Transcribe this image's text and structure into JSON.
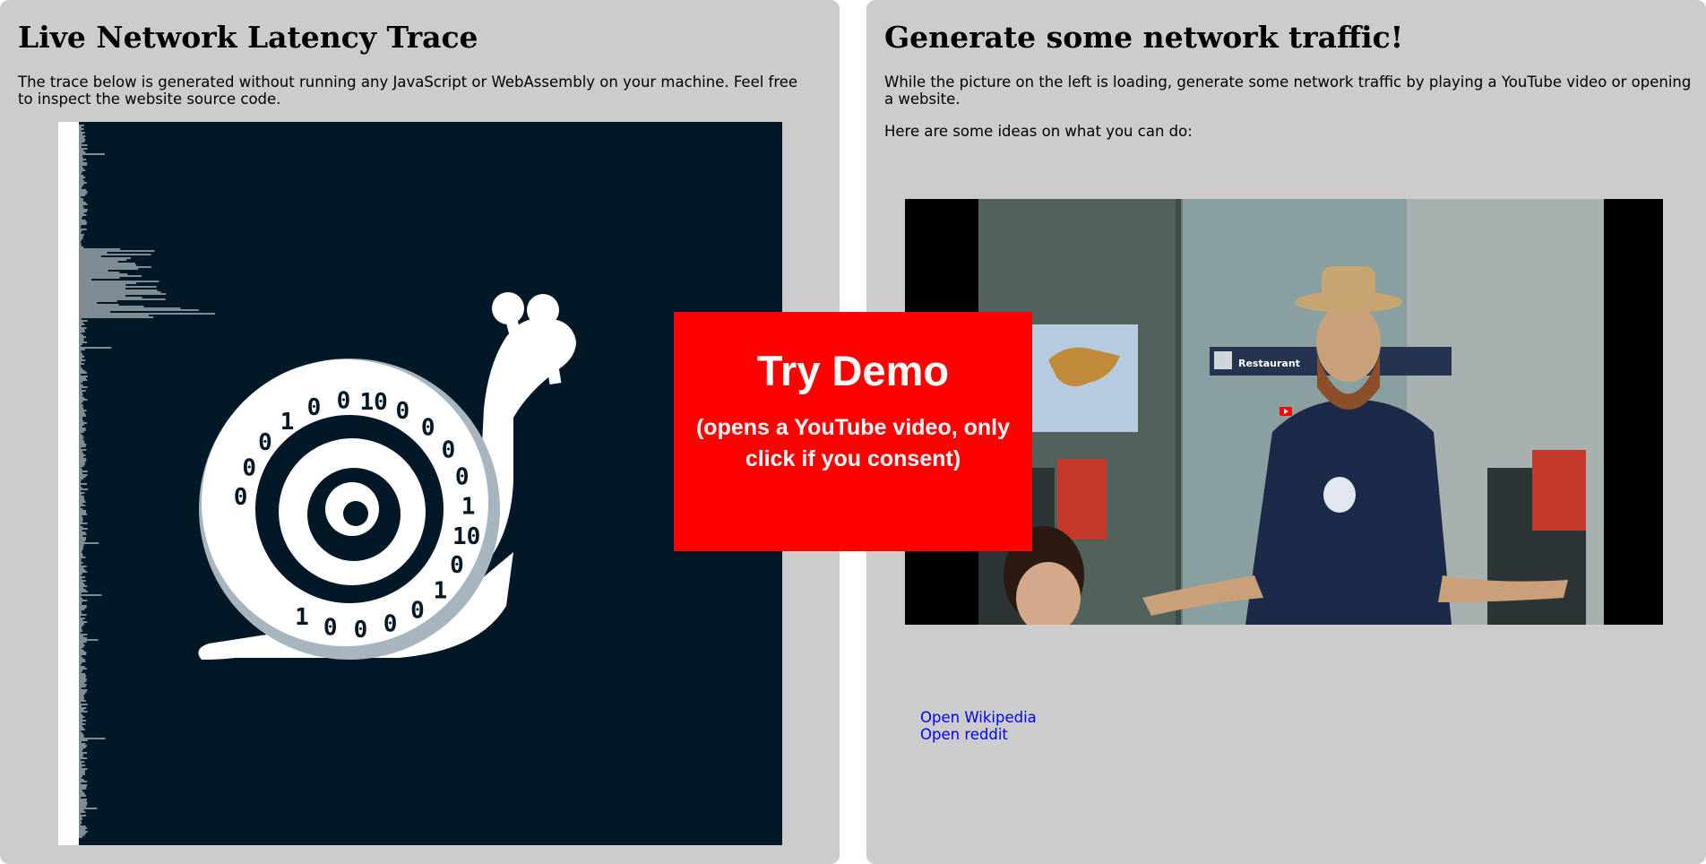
{
  "left": {
    "title": "Live Network Latency Trace",
    "description": "The trace below is generated without running any JavaScript or WebAssembly on your machine. Feel free to inspect the website source code.",
    "trace": {
      "background_color": "#021827",
      "snail_digits": [
        "0",
        "0",
        "0",
        "1",
        "0",
        "0",
        "10",
        "0",
        "0",
        "0",
        "0",
        "1",
        "10",
        "0",
        "1",
        "0",
        "0",
        "0",
        "0",
        "1"
      ]
    }
  },
  "demo_button": {
    "title": "Try Demo",
    "subtitle": "(opens a YouTube video, only click if you consent)",
    "color": "#ff0000"
  },
  "right": {
    "title": "Generate some network traffic!",
    "description": "While the picture on the left is loading, generate some network traffic by playing a YouTube video or opening a website.",
    "ideas": "Here are some ideas on what you can do:",
    "video": {
      "sign_text": "Restaurant",
      "play_icon": "youtube-play-icon"
    },
    "links": [
      "Open Wikipedia",
      "Open reddit"
    ]
  }
}
